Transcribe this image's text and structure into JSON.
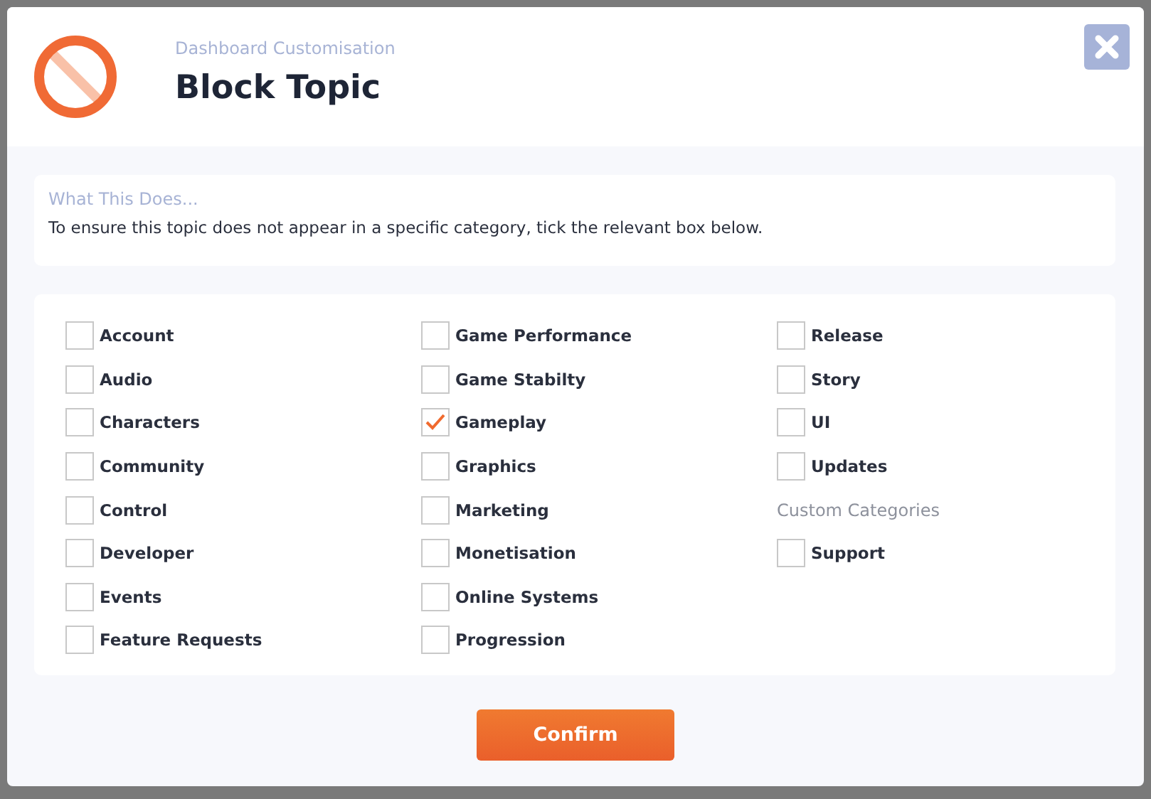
{
  "dialog": {
    "subtitle": "Dashboard Customisation",
    "title": "Block Topic"
  },
  "info": {
    "heading": "What This Does...",
    "text": "To ensure this topic does not appear in a specific category, tick the relevant box below."
  },
  "columns": [
    [
      {
        "kind": "checkbox",
        "label": "Account",
        "checked": false
      },
      {
        "kind": "checkbox",
        "label": "Audio",
        "checked": false
      },
      {
        "kind": "checkbox",
        "label": "Characters",
        "checked": false
      },
      {
        "kind": "checkbox",
        "label": "Community",
        "checked": false
      },
      {
        "kind": "checkbox",
        "label": "Control",
        "checked": false
      },
      {
        "kind": "checkbox",
        "label": "Developer",
        "checked": false
      },
      {
        "kind": "checkbox",
        "label": "Events",
        "checked": false
      },
      {
        "kind": "checkbox",
        "label": "Feature Requests",
        "checked": false
      }
    ],
    [
      {
        "kind": "checkbox",
        "label": "Game Performance",
        "checked": false
      },
      {
        "kind": "checkbox",
        "label": "Game Stabilty",
        "checked": false
      },
      {
        "kind": "checkbox",
        "label": "Gameplay",
        "checked": true
      },
      {
        "kind": "checkbox",
        "label": "Graphics",
        "checked": false
      },
      {
        "kind": "checkbox",
        "label": "Marketing",
        "checked": false
      },
      {
        "kind": "checkbox",
        "label": "Monetisation",
        "checked": false
      },
      {
        "kind": "checkbox",
        "label": "Online Systems",
        "checked": false
      },
      {
        "kind": "checkbox",
        "label": "Progression",
        "checked": false
      }
    ],
    [
      {
        "kind": "checkbox",
        "label": "Release",
        "checked": false
      },
      {
        "kind": "checkbox",
        "label": "Story",
        "checked": false
      },
      {
        "kind": "checkbox",
        "label": "UI",
        "checked": false
      },
      {
        "kind": "checkbox",
        "label": "Updates",
        "checked": false
      },
      {
        "kind": "heading",
        "label": "Custom Categories"
      },
      {
        "kind": "checkbox",
        "label": "Support",
        "checked": false
      }
    ]
  ],
  "confirm_button": "Confirm"
}
